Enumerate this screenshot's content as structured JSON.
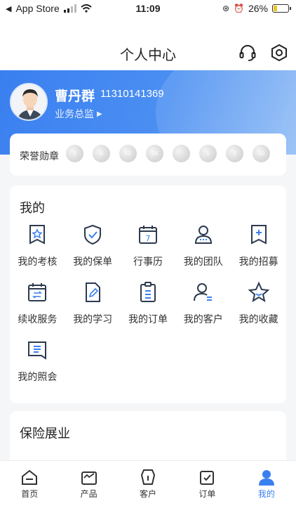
{
  "status_bar": {
    "back_label": "App Store",
    "time": "11:09",
    "battery_level": "26%",
    "battery_fraction": 0.26
  },
  "nav": {
    "title": "个人中心",
    "support_icon": "headset-icon",
    "settings_icon": "settings-icon"
  },
  "profile": {
    "name": "曹丹群",
    "phone": "11310141369",
    "role": "业务总监"
  },
  "medals": {
    "label": "荣誉勋章",
    "items": [
      "3",
      "6",
      "12",
      "24",
      "",
      "1",
      "3",
      "10"
    ]
  },
  "my_section": {
    "title": "我的",
    "items": [
      {
        "label": "我的考核",
        "icon": "banner-star-icon"
      },
      {
        "label": "我的保单",
        "icon": "shield-check-icon"
      },
      {
        "label": "行事历",
        "icon": "calendar-7-icon"
      },
      {
        "label": "我的团队",
        "icon": "person-team-icon"
      },
      {
        "label": "我的招募",
        "icon": "banner-plus-icon"
      },
      {
        "label": "续收服务",
        "icon": "calendar-exchange-icon"
      },
      {
        "label": "我的学习",
        "icon": "doc-pen-icon"
      },
      {
        "label": "我的订单",
        "icon": "clipboard-list-icon"
      },
      {
        "label": "我的客户",
        "icon": "person-list-icon"
      },
      {
        "label": "我的收藏",
        "icon": "star-icon"
      },
      {
        "label": "我的照会",
        "icon": "note-icon"
      }
    ]
  },
  "insurance_section": {
    "title": "保险展业"
  },
  "tabbar": {
    "tabs": [
      {
        "label": "首页",
        "icon": "home-icon"
      },
      {
        "label": "产品",
        "icon": "product-box-icon"
      },
      {
        "label": "客户",
        "icon": "customer-icon"
      },
      {
        "label": "订单",
        "icon": "order-icon"
      },
      {
        "label": "我的",
        "icon": "my-profile-icon",
        "active": true
      }
    ]
  },
  "colors": {
    "accent": "#3a7ff0",
    "icon_stroke": "#2c3a4f"
  }
}
